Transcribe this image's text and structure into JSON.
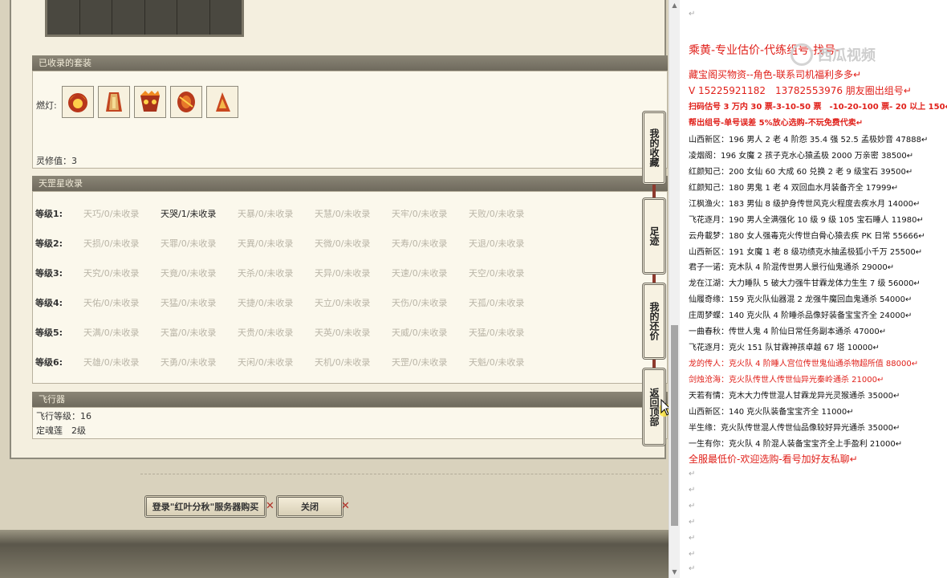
{
  "collected": {
    "title": "已收录的套装",
    "lamp_label": "燃灯:",
    "icons": [
      "fire-helmet-icon",
      "fire-robe-icon",
      "fire-mask-icon",
      "fire-wrist-icon",
      "fire-boot-icon"
    ],
    "spirit": "灵修值：3"
  },
  "tiangang": {
    "title": "天罡星收录",
    "rows": [
      {
        "label": "等级1:",
        "cells": [
          "天巧/0/未收录",
          "天哭/1/未收录",
          "天暴/0/未收录",
          "天慧/0/未收录",
          "天牢/0/未收录",
          "天败/0/未收录"
        ]
      },
      {
        "label": "等级2:",
        "cells": [
          "天损/0/未收录",
          "天罪/0/未收录",
          "天異/0/未收录",
          "天微/0/未收录",
          "天寿/0/未收录",
          "天退/0/未收录"
        ]
      },
      {
        "label": "等级3:",
        "cells": [
          "天究/0/未收录",
          "天竟/0/未收录",
          "天杀/0/未收录",
          "天异/0/未收录",
          "天速/0/未收录",
          "天空/0/未收录"
        ]
      },
      {
        "label": "等级4:",
        "cells": [
          "天佑/0/未收录",
          "天猛/0/未收录",
          "天捷/0/未收录",
          "天立/0/未收录",
          "天伤/0/未收录",
          "天孤/0/未收录"
        ]
      },
      {
        "label": "等级5:",
        "cells": [
          "天满/0/未收录",
          "天富/0/未收录",
          "天贵/0/未收录",
          "天英/0/未收录",
          "天威/0/未收录",
          "天猛/0/未收录"
        ]
      },
      {
        "label": "等级6:",
        "cells": [
          "天雄/0/未收录",
          "天勇/0/未收录",
          "天闲/0/未收录",
          "天机/0/未收录",
          "天罡/0/未收录",
          "天魁/0/未收录"
        ]
      }
    ]
  },
  "fly": {
    "title": "飞行器",
    "level": "飞行等级：16",
    "soul": "定魂莲　2级"
  },
  "buttons": {
    "login": "登录\"红叶分秋\"服务器购买",
    "close": "关闭",
    "x": "✕"
  },
  "side_tabs": [
    "我的收藏",
    "足迹",
    "我的还价",
    "返回顶部"
  ],
  "doc": {
    "pmark": "↵",
    "title": "乘黄-专业估价-代练组号-找号-",
    "l1": "藏宝阁买物资--角色-联系司机福利多多↵",
    "l2": "V 15225921182　13782553976 朋友圈出组号↵",
    "l3": "扫码估号 3 万内 30 票-3-10-50 票　-10-20-100 票- 20 以上 150↵",
    "l4": "帮出组号-单号误差 5%放心选购-不玩免费代卖↵",
    "entries": [
      {
        "text": "山西新区：196 男人 2 老 4 阶怨 35.4 强 52.5 孟极妙音 47888↵",
        "red": false
      },
      {
        "text": "凌烟阁：196 女魔 2 孩子克水心猿孟极 2000 万亲密 38500↵",
        "red": false
      },
      {
        "text": "红颜知己：200 女仙 60 大成 60 兑换 2 老 9 级宝石 39500↵",
        "red": false
      },
      {
        "text": "红颜知己：180 男鬼 1 老 4 双回血水月装备齐全 17999↵",
        "red": false
      },
      {
        "text": "江枫渔火：183 男仙 8 级护身传世风克火程度去疾水月 14000↵",
        "red": false
      },
      {
        "text": "飞花逐月：190 男人全满强化 10 级 9 级 105 宝石睡人 11980↵",
        "red": false
      },
      {
        "text": "云舟載梦：180 女人强毒克火传世白骨心猿去疾 PK 日常 55666↵",
        "red": false
      },
      {
        "text": "山西新区：191 女魔 1 老 8 级功绩克水抽孟极狐小千万 25500↵",
        "red": false
      },
      {
        "text": "君子一诺：克木队 4 阶混传世男人景行仙鬼通杀 29000↵",
        "red": false
      },
      {
        "text": "龙在江湖：大力睡队 5 破大力强牛甘霖龙体力生生 7 级 56000↵",
        "red": false
      },
      {
        "text": "仙履奇缘：159 克火队仙器混 2 龙强牛魔回血鬼通杀 54000↵",
        "red": false
      },
      {
        "text": "庄周梦蝶：140 克火队 4 阶睡杀品像好装备宝宝齐全 24000↵",
        "red": false
      },
      {
        "text": "一曲春秋：传世人鬼 4 阶仙日常任务副本通杀 47000↵",
        "red": false
      },
      {
        "text": "飞花逐月：克火 151 队甘霖神孩卓越 67 塔 10000↵",
        "red": false
      },
      {
        "text": "龙的传人：克火队 4 阶睡人宫位传世鬼仙通杀物超所值 88000↵",
        "red": true
      },
      {
        "text": "剑烛沧海：克火队传世人传世仙异光秦岭通杀 21000↵",
        "red": true
      },
      {
        "text": "天若有情：克木大力传世混人甘霖龙异光灵猴通杀 35000↵",
        "red": false
      },
      {
        "text": "山西新区：140 克火队装备宝宝齐全 11000↵",
        "red": false
      },
      {
        "text": "半生缘：克火队传世混人传世仙品像较好异光通杀 35000↵",
        "red": false
      },
      {
        "text": "一生有你：克火队 4 阶混人装备宝宝齐全上手盈利 21000↵",
        "red": false
      }
    ],
    "footer": "全服最低价-欢迎选购-看号加好友私聊↵"
  },
  "watermark": "西瓜视频",
  "colors": {
    "red": "#e0201a",
    "panel_bg": "#f4efdf",
    "section_bar": "#7d7868"
  }
}
